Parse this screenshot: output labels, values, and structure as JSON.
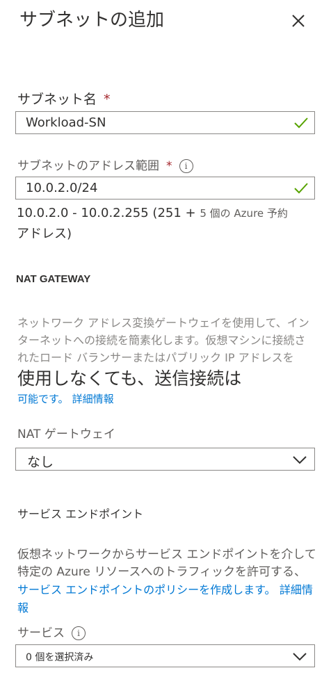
{
  "panel": {
    "title": "サブネットの追加"
  },
  "subnet_name": {
    "label": "サブネット名",
    "required_mark": "*",
    "value": "Workload-SN"
  },
  "address_range": {
    "label": "サブネットのアドレス範囲",
    "required_mark": "*",
    "info_icon": "i",
    "value": "10.0.2.0/24",
    "summary_main": "10.0.2.0 - 10.0.2.255 (251 +",
    "summary_small": "5 個の Azure 予約",
    "summary_tail": "アドレス)"
  },
  "nat": {
    "heading": "NAT GATEWAY",
    "description": "ネットワーク アドレス変換ゲートウェイを使用して、インターネットへの接続を簡素化します。仮想マシンに接続されたロード バランサーまたはパブリック IP アドレスを",
    "description_big": "使用しなくても、送信接続は",
    "description_end": "可能です。",
    "learn_more": "詳細情報",
    "label": "NAT ゲートウェイ",
    "selected": "なし"
  },
  "service_endpoints": {
    "heading": "サービス エンドポイント",
    "description": "仮想ネットワークからサービス エンドポイントを介して特定の Azure リソースへのトラフィックを許可する、",
    "policy_link": "サービス エンドポイントのポリシーを作成します。",
    "learn_more": "詳細情報",
    "services_label": "サービス",
    "info_icon": "i",
    "services_selected": "0 個を選択済み"
  },
  "colors": {
    "check": "#57a300",
    "link": "#0078d4",
    "required": "#a4262c"
  }
}
